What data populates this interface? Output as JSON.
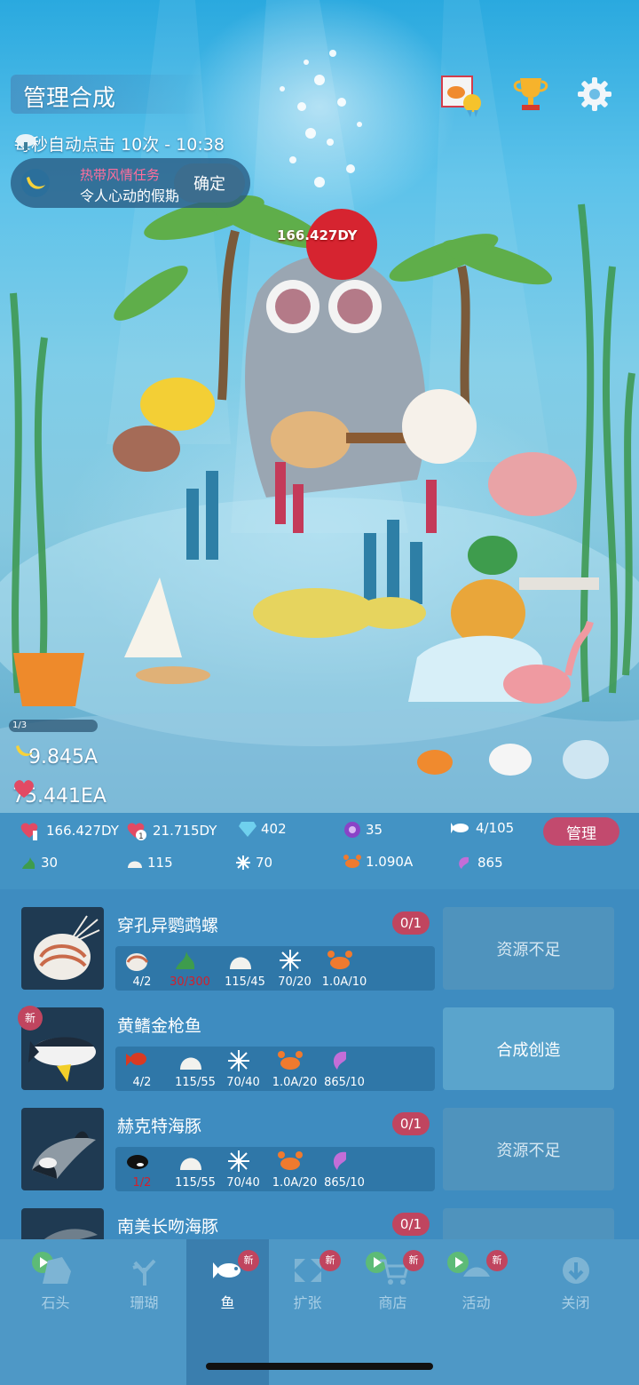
{
  "header": {
    "title": "管理合成",
    "auto_click": "每秒自动点击 10次 - 10:38"
  },
  "quest": {
    "title": "热带风情任务",
    "subtitle": "令人心动的假期",
    "confirm_label": "确定"
  },
  "scene": {
    "floating_value": "166.427DY",
    "progress_label": "1/3"
  },
  "resources": {
    "banana": "9.845A",
    "heart": "75.441EA"
  },
  "stats": {
    "tap_value": "166.427DY",
    "timer_value": "21.715DY",
    "gem": "402",
    "purple": "35",
    "fish_count": "4/105",
    "manage_label": "管理",
    "seaweed": "30",
    "shell": "115",
    "urchin": "70",
    "crab": "1.090A",
    "shrimp": "865"
  },
  "list": [
    {
      "name": "穿孔异鹦鹉螺",
      "count": "0/1",
      "action": "资源不足",
      "is_new": false,
      "reqs": [
        "4/2",
        "30/300",
        "115/45",
        "70/20",
        "1.0A/10"
      ],
      "req_icons": [
        "nautilus-icon",
        "seaweed-icon",
        "shell-icon",
        "urchin-icon",
        "crab-icon"
      ],
      "req_red": [
        false,
        true,
        false,
        false,
        false
      ]
    },
    {
      "name": "黄鳍金枪鱼",
      "count": "",
      "action": "合成创造",
      "is_new": true,
      "new_label": "新",
      "reqs": [
        "4/2",
        "115/55",
        "70/40",
        "1.0A/20",
        "865/10"
      ],
      "req_icons": [
        "goldfish-icon",
        "shell-icon",
        "urchin-icon",
        "crab-icon",
        "shrimp-icon"
      ],
      "req_red": [
        false,
        false,
        false,
        false,
        false
      ]
    },
    {
      "name": "赫克特海豚",
      "count": "0/1",
      "action": "资源不足",
      "is_new": false,
      "reqs": [
        "1/2",
        "115/55",
        "70/40",
        "1.0A/20",
        "865/10"
      ],
      "req_icons": [
        "orca-icon",
        "shell-icon",
        "urchin-icon",
        "crab-icon",
        "shrimp-icon"
      ],
      "req_red": [
        true,
        false,
        false,
        false,
        false
      ]
    },
    {
      "name": "南美长吻海豚",
      "count": "0/1",
      "action": "",
      "is_new": false,
      "reqs": [],
      "req_icons": [],
      "req_red": []
    }
  ],
  "nav": {
    "items": [
      {
        "label": "石头",
        "icon": "rock-icon",
        "play": true,
        "new": false
      },
      {
        "label": "珊瑚",
        "icon": "coral-icon",
        "play": false,
        "new": false
      },
      {
        "label": "鱼",
        "icon": "fish-icon",
        "play": false,
        "new": true
      },
      {
        "label": "扩张",
        "icon": "expand-icon",
        "play": false,
        "new": true
      },
      {
        "label": "商店",
        "icon": "cart-icon",
        "play": true,
        "new": true
      },
      {
        "label": "活动",
        "icon": "event-icon",
        "play": true,
        "new": true
      },
      {
        "label": "关闭",
        "icon": "close-down-icon",
        "play": false,
        "new": false
      }
    ],
    "new_label": "新",
    "active_index": 2
  },
  "colors": {
    "accent_pink": "#c24a6e",
    "badge_red": "#c0455f",
    "shortage_red": "#d2202c",
    "panel_blue": "#3e8cc0"
  }
}
